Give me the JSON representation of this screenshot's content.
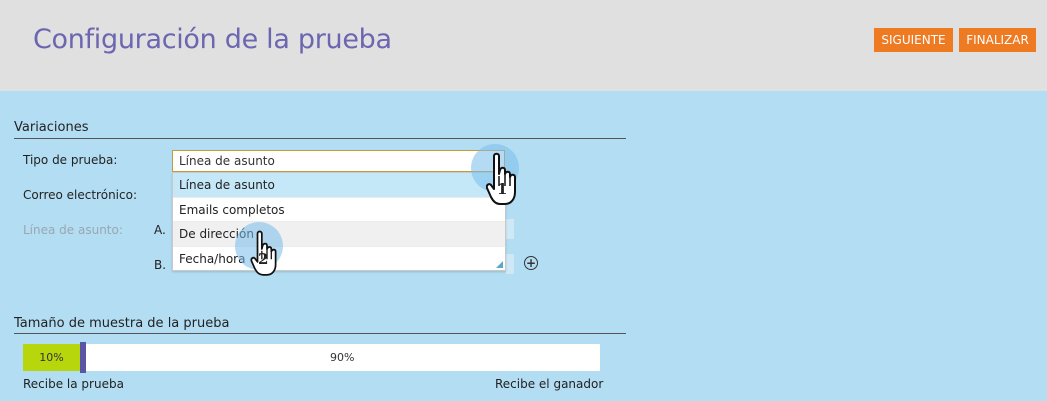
{
  "header": {
    "title": "Configuración de la prueba",
    "next_label": "SIGUIENTE",
    "finish_label": "FINALIZAR"
  },
  "variations": {
    "section_title": "Variaciones",
    "test_type_label": "Tipo de prueba:",
    "test_type_value": "Línea de asunto",
    "email_label": "Correo electrónico:",
    "subject_line_label": "Línea de asunto:",
    "option_a": "A.",
    "option_b": "B.",
    "dropdown_options": [
      "Línea de asunto",
      "Emails completos",
      "De dirección",
      "Fecha/hora"
    ]
  },
  "sample": {
    "section_title": "Tamaño de muestra de la prueba",
    "test_percent": 10,
    "test_percent_label": "10%",
    "winner_percent_label": "90%",
    "test_caption": "Recibe la prueba",
    "winner_caption": "Recibe el ganador"
  },
  "annotations": {
    "step1": "1",
    "step2": "2"
  },
  "colors": {
    "accent_orange": "#ee7a22",
    "title_purple": "#6b66b0",
    "bar_green": "#b8d60c",
    "background_blue": "#b3ddf2"
  },
  "icons": [
    "add-circle-icon",
    "hand-pointer-icon",
    "resize-corner-icon"
  ]
}
